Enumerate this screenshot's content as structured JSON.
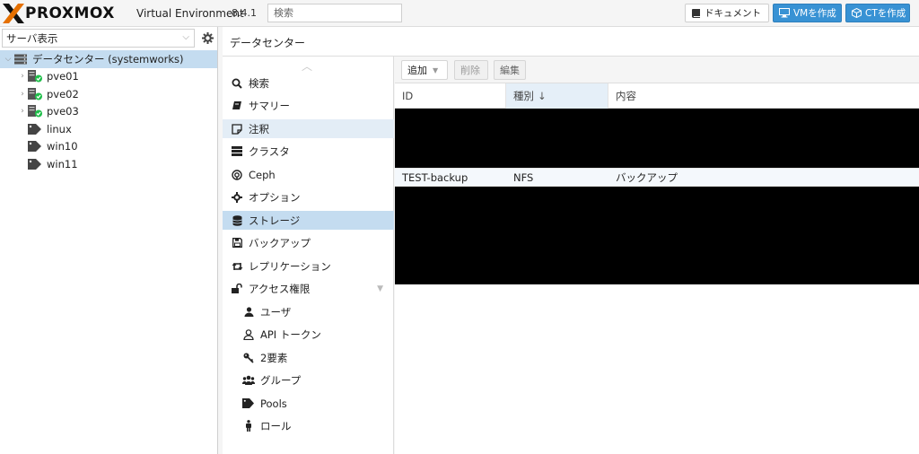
{
  "topbar": {
    "logo_x1": "X",
    "logo_word": "PROXMOX",
    "product": "Virtual Environment",
    "version": "8.4.1",
    "search_placeholder": "検索",
    "docs_label": "ドキュメント",
    "create_vm_label": "VMを作成",
    "create_ct_label": "CTを作成",
    "accent_color": "#e57000",
    "button_color": "#3892d4"
  },
  "sidebar": {
    "view_label": "サーバ表示",
    "tree": [
      {
        "label": "データセンター (systemworks)",
        "icon": "datacenter-icon",
        "selected": true
      },
      {
        "label": "pve01",
        "icon": "node-online-icon"
      },
      {
        "label": "pve02",
        "icon": "node-online-icon"
      },
      {
        "label": "pve03",
        "icon": "node-online-icon"
      },
      {
        "label": "linux",
        "icon": "tag-icon"
      },
      {
        "label": "win10",
        "icon": "tag-icon"
      },
      {
        "label": "win11",
        "icon": "tag-icon"
      }
    ]
  },
  "content": {
    "header_title": "データセンター",
    "menu": [
      {
        "label": "検索",
        "icon": "search-icon"
      },
      {
        "label": "サマリー",
        "icon": "book-icon"
      },
      {
        "label": "注釈",
        "icon": "note-icon"
      },
      {
        "label": "クラスタ",
        "icon": "server-icon"
      },
      {
        "label": "Ceph",
        "icon": "ceph-icon"
      },
      {
        "label": "オプション",
        "icon": "gear-icon"
      },
      {
        "label": "ストレージ",
        "icon": "database-icon",
        "active": true
      },
      {
        "label": "バックアップ",
        "icon": "floppy-icon"
      },
      {
        "label": "レプリケーション",
        "icon": "retweet-icon"
      },
      {
        "label": "アクセス権限",
        "icon": "unlock-icon"
      },
      {
        "label": "ユーザ",
        "icon": "user-icon"
      },
      {
        "label": "API トークン",
        "icon": "user-outline-icon"
      },
      {
        "label": "2要素",
        "icon": "key-icon"
      },
      {
        "label": "グループ",
        "icon": "users-icon"
      },
      {
        "label": "Pools",
        "icon": "tags-icon"
      },
      {
        "label": "ロール",
        "icon": "male-icon"
      }
    ],
    "toolbar": {
      "add_label": "追加",
      "delete_label": "削除",
      "edit_label": "編集"
    },
    "grid": {
      "columns": [
        "ID",
        "種別",
        "内容"
      ],
      "sorted_column": "種別",
      "sort_indicator": "↓",
      "rows": [
        {
          "id": "TEST-backup",
          "type": "NFS",
          "content": "バックアップ"
        }
      ]
    }
  }
}
